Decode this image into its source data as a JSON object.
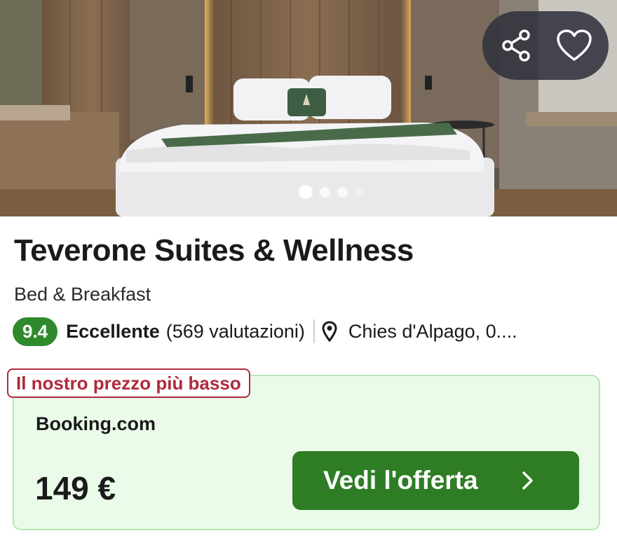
{
  "hotel": {
    "name": "Teverone Suites & Wellness",
    "type": "Bed & Breakfast",
    "score": "9.4",
    "rating_label": "Eccellente",
    "rating_count": "(569 valutazioni)",
    "location": "Chies d'Alpago, 0...."
  },
  "gallery": {
    "dot_count": 4,
    "active_index": 0
  },
  "actions": {
    "share_icon": "share-icon",
    "favorite_icon": "heart-icon"
  },
  "offer": {
    "badge": "Il nostro prezzo più basso",
    "provider": "Booking.com",
    "price": "149 €",
    "cta_label": "Vedi l'offerta",
    "cta_icon": "chevron-right-icon"
  },
  "colors": {
    "score_green": "#2f8a2c",
    "cta_green": "#2e7d25",
    "offer_bg": "#ebfbea",
    "offer_border": "#b6e7b4",
    "badge_red": "#b02a3c"
  }
}
